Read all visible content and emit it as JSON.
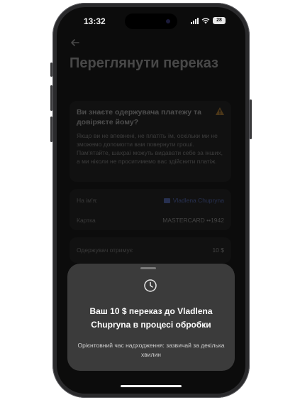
{
  "status_bar": {
    "time": "13:32",
    "battery": "28"
  },
  "background_screen": {
    "title": "Переглянути переказ",
    "warning": {
      "title": "Ви знаєте одержувача платежу та довіряєте йому?",
      "body": "Якщо ви не впевнені, не платіть їм, оскільки ми не зможемо допомогти вам повернути гроші. Пам'ятайте, шахраї можуть видавати себе за інших, а ми ніколи не проситимемо вас здійснити платіж.",
      "icon": "warning-triangle-icon"
    },
    "details": [
      {
        "label": "На ім'я:",
        "value": "Vladlena Chupryna"
      },
      {
        "label": "Картка",
        "value": "MASTERCARD ••1942"
      }
    ],
    "recipient": {
      "label": "Одержувач отримує",
      "value": "10 $"
    }
  },
  "sheet": {
    "icon": "clock-icon",
    "title": "Ваш 10 $ переказ до Vladlena Chupryna в процесі обробки",
    "subtitle": "Орієнтовний час надходження: зазвичай за декілька хвилин"
  },
  "colors": {
    "accent": "#6c8dff",
    "warning": "#f0a53a",
    "sheet_bg": "#3b3b3b",
    "screen_bg": "#0c0c0c"
  }
}
